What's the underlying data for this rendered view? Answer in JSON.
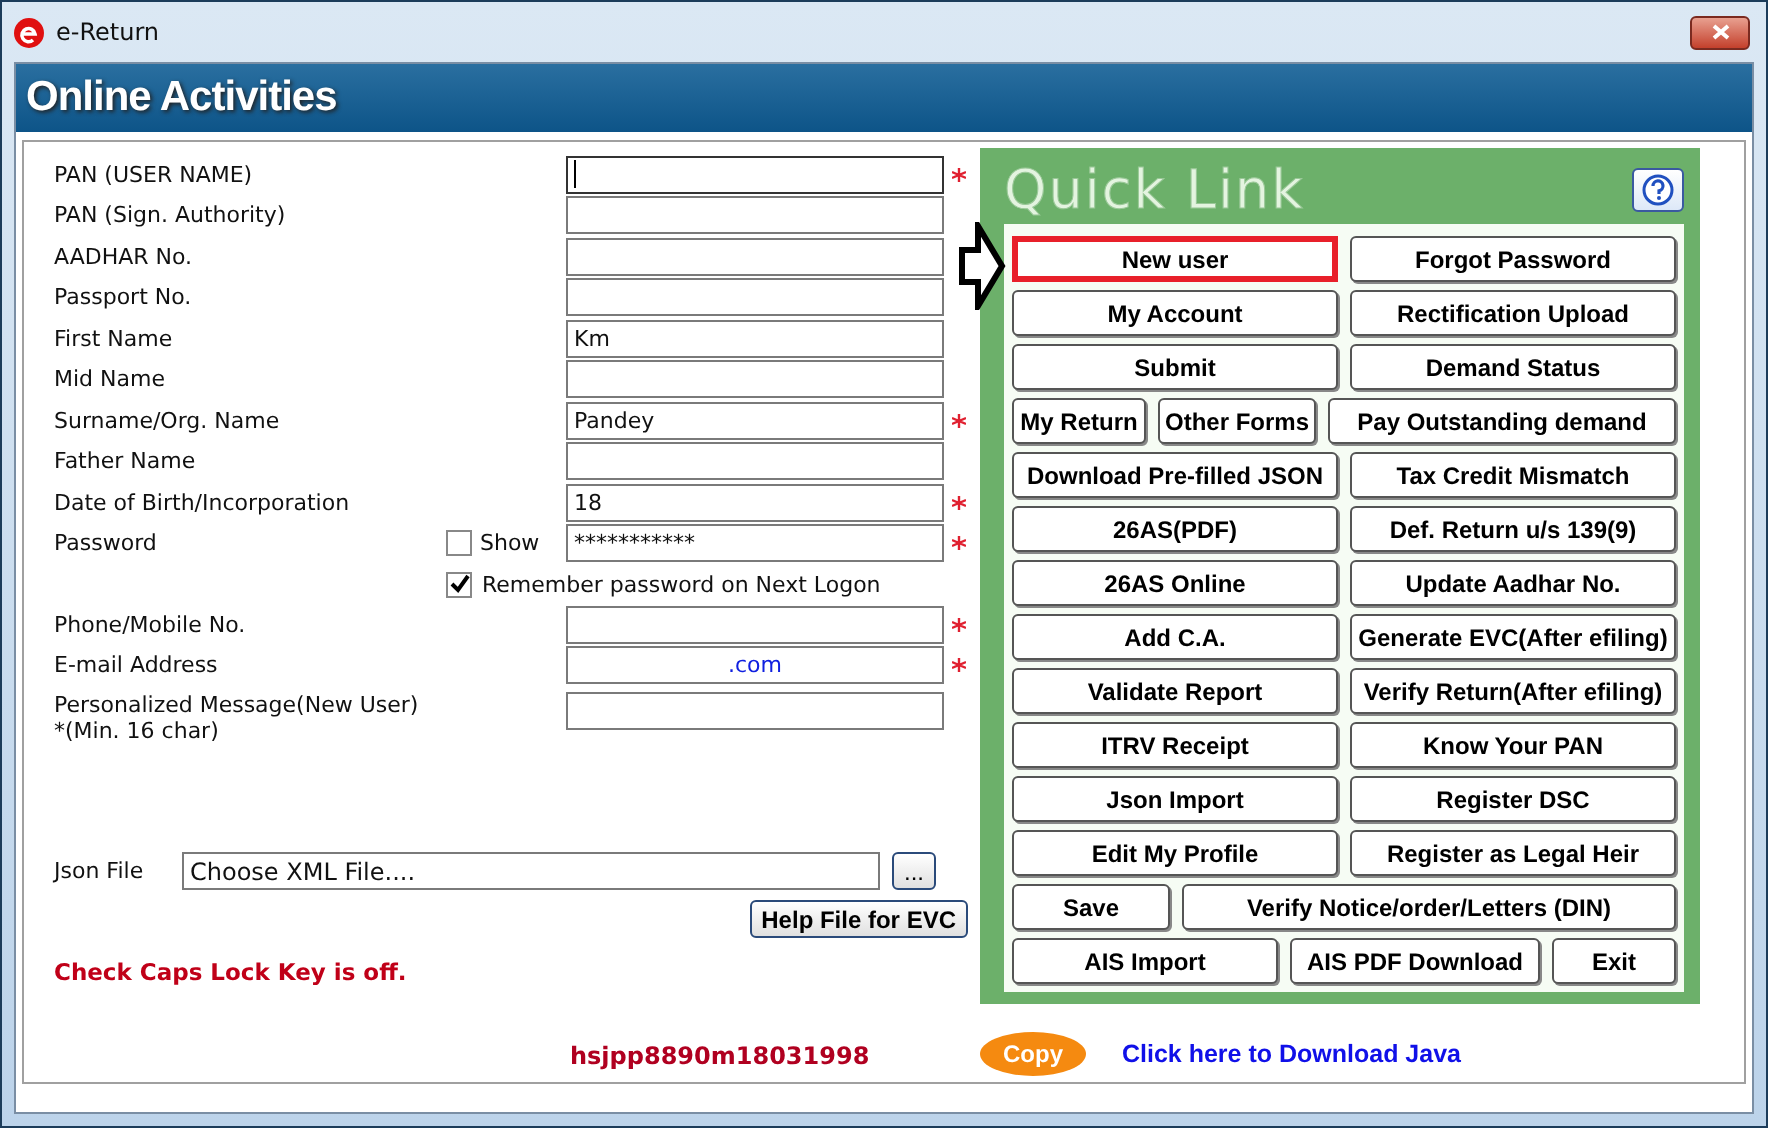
{
  "window": {
    "title": "e-Return"
  },
  "header": {
    "title": "Online Activities"
  },
  "form": {
    "fields": [
      {
        "kind": "text",
        "label": "PAN (USER NAME)",
        "required": true,
        "focused": true
      },
      {
        "kind": "text",
        "label": "PAN (Sign. Authority)",
        "required": false,
        "focused": false
      },
      {
        "kind": "text",
        "label": "AADHAR No.",
        "required": false,
        "focused": false
      },
      {
        "kind": "text",
        "label": "Passport No.",
        "required": false,
        "focused": false
      },
      {
        "kind": "text",
        "label": "First Name",
        "value": "Km",
        "required": false,
        "focused": false
      },
      {
        "kind": "text",
        "label": "Mid Name",
        "required": false,
        "focused": false
      },
      {
        "kind": "text",
        "label": "Surname/Org. Name",
        "value": "Pandey",
        "required": true,
        "focused": false
      },
      {
        "kind": "text",
        "label": "Father Name",
        "required": false,
        "focused": false
      },
      {
        "kind": "text",
        "label": "Date of Birth/Incorporation",
        "value": "18",
        "required": true,
        "focused": false
      },
      {
        "kind": "password",
        "label": "Password",
        "value": "***********",
        "required": true,
        "focused": false,
        "show_label": "Show",
        "show_checked": false
      },
      {
        "kind": "checkbox",
        "label": "Remember password on Next Logon",
        "checked": true
      },
      {
        "kind": "text",
        "label": "Phone/Mobile No.",
        "required": true,
        "focused": false
      },
      {
        "kind": "email",
        "label": "E-mail Address",
        "value": ".com",
        "required": true,
        "focused": false
      },
      {
        "kind": "text",
        "label": "Personalized Message(New User)",
        "note": "*(Min. 16 char)",
        "required": false,
        "focused": false
      }
    ],
    "json_file": {
      "label": "Json File",
      "value": "Choose XML File....",
      "browse": "..."
    },
    "help_button": "Help File for EVC",
    "caps_message": "Check Caps Lock Key is off.",
    "code": "hsjpp8890m18031998"
  },
  "quick_link": {
    "title": "Quick Link",
    "rows": [
      [
        {
          "label": "New user",
          "highlighted": true
        },
        {
          "label": "Forgot Password",
          "highlighted": false
        }
      ],
      [
        {
          "label": "My Account",
          "highlighted": false
        },
        {
          "label": "Rectification Upload",
          "highlighted": false
        }
      ],
      [
        {
          "label": "Submit",
          "highlighted": false
        },
        {
          "label": "Demand Status",
          "highlighted": false
        }
      ],
      [
        {
          "label": "My Return",
          "highlighted": false
        },
        {
          "label": "Other Forms",
          "highlighted": false
        },
        {
          "label": "Pay Outstanding demand",
          "highlighted": false
        }
      ],
      [
        {
          "label": "Download Pre-filled JSON",
          "highlighted": false
        },
        {
          "label": "Tax Credit Mismatch",
          "highlighted": false
        }
      ],
      [
        {
          "label": "26AS(PDF)",
          "highlighted": false
        },
        {
          "label": "Def. Return u/s 139(9)",
          "highlighted": false
        }
      ],
      [
        {
          "label": "26AS Online",
          "highlighted": false
        },
        {
          "label": "Update Aadhar No.",
          "highlighted": false
        }
      ],
      [
        {
          "label": "Add C.A.",
          "highlighted": false
        },
        {
          "label": "Generate EVC(After efiling)",
          "highlighted": false
        }
      ],
      [
        {
          "label": "Validate Report",
          "highlighted": false
        },
        {
          "label": "Verify Return(After efiling)",
          "highlighted": false
        }
      ],
      [
        {
          "label": "ITRV Receipt",
          "highlighted": false
        },
        {
          "label": "Know Your PAN",
          "highlighted": false
        }
      ],
      [
        {
          "label": "Json Import",
          "highlighted": false
        },
        {
          "label": "Register DSC",
          "highlighted": false
        }
      ],
      [
        {
          "label": "Edit My Profile",
          "highlighted": false
        },
        {
          "label": "Register as Legal Heir",
          "highlighted": false
        }
      ],
      [
        {
          "label": "Save",
          "highlighted": false
        },
        {
          "label": "Verify Notice/order/Letters (DIN)",
          "highlighted": false
        }
      ],
      [
        {
          "label": "AIS Import",
          "highlighted": false
        },
        {
          "label": "AIS PDF Download",
          "highlighted": false
        },
        {
          "label": "Exit",
          "highlighted": false
        }
      ]
    ]
  },
  "footer": {
    "copy": "Copy",
    "link": "Click here to Download Java"
  }
}
